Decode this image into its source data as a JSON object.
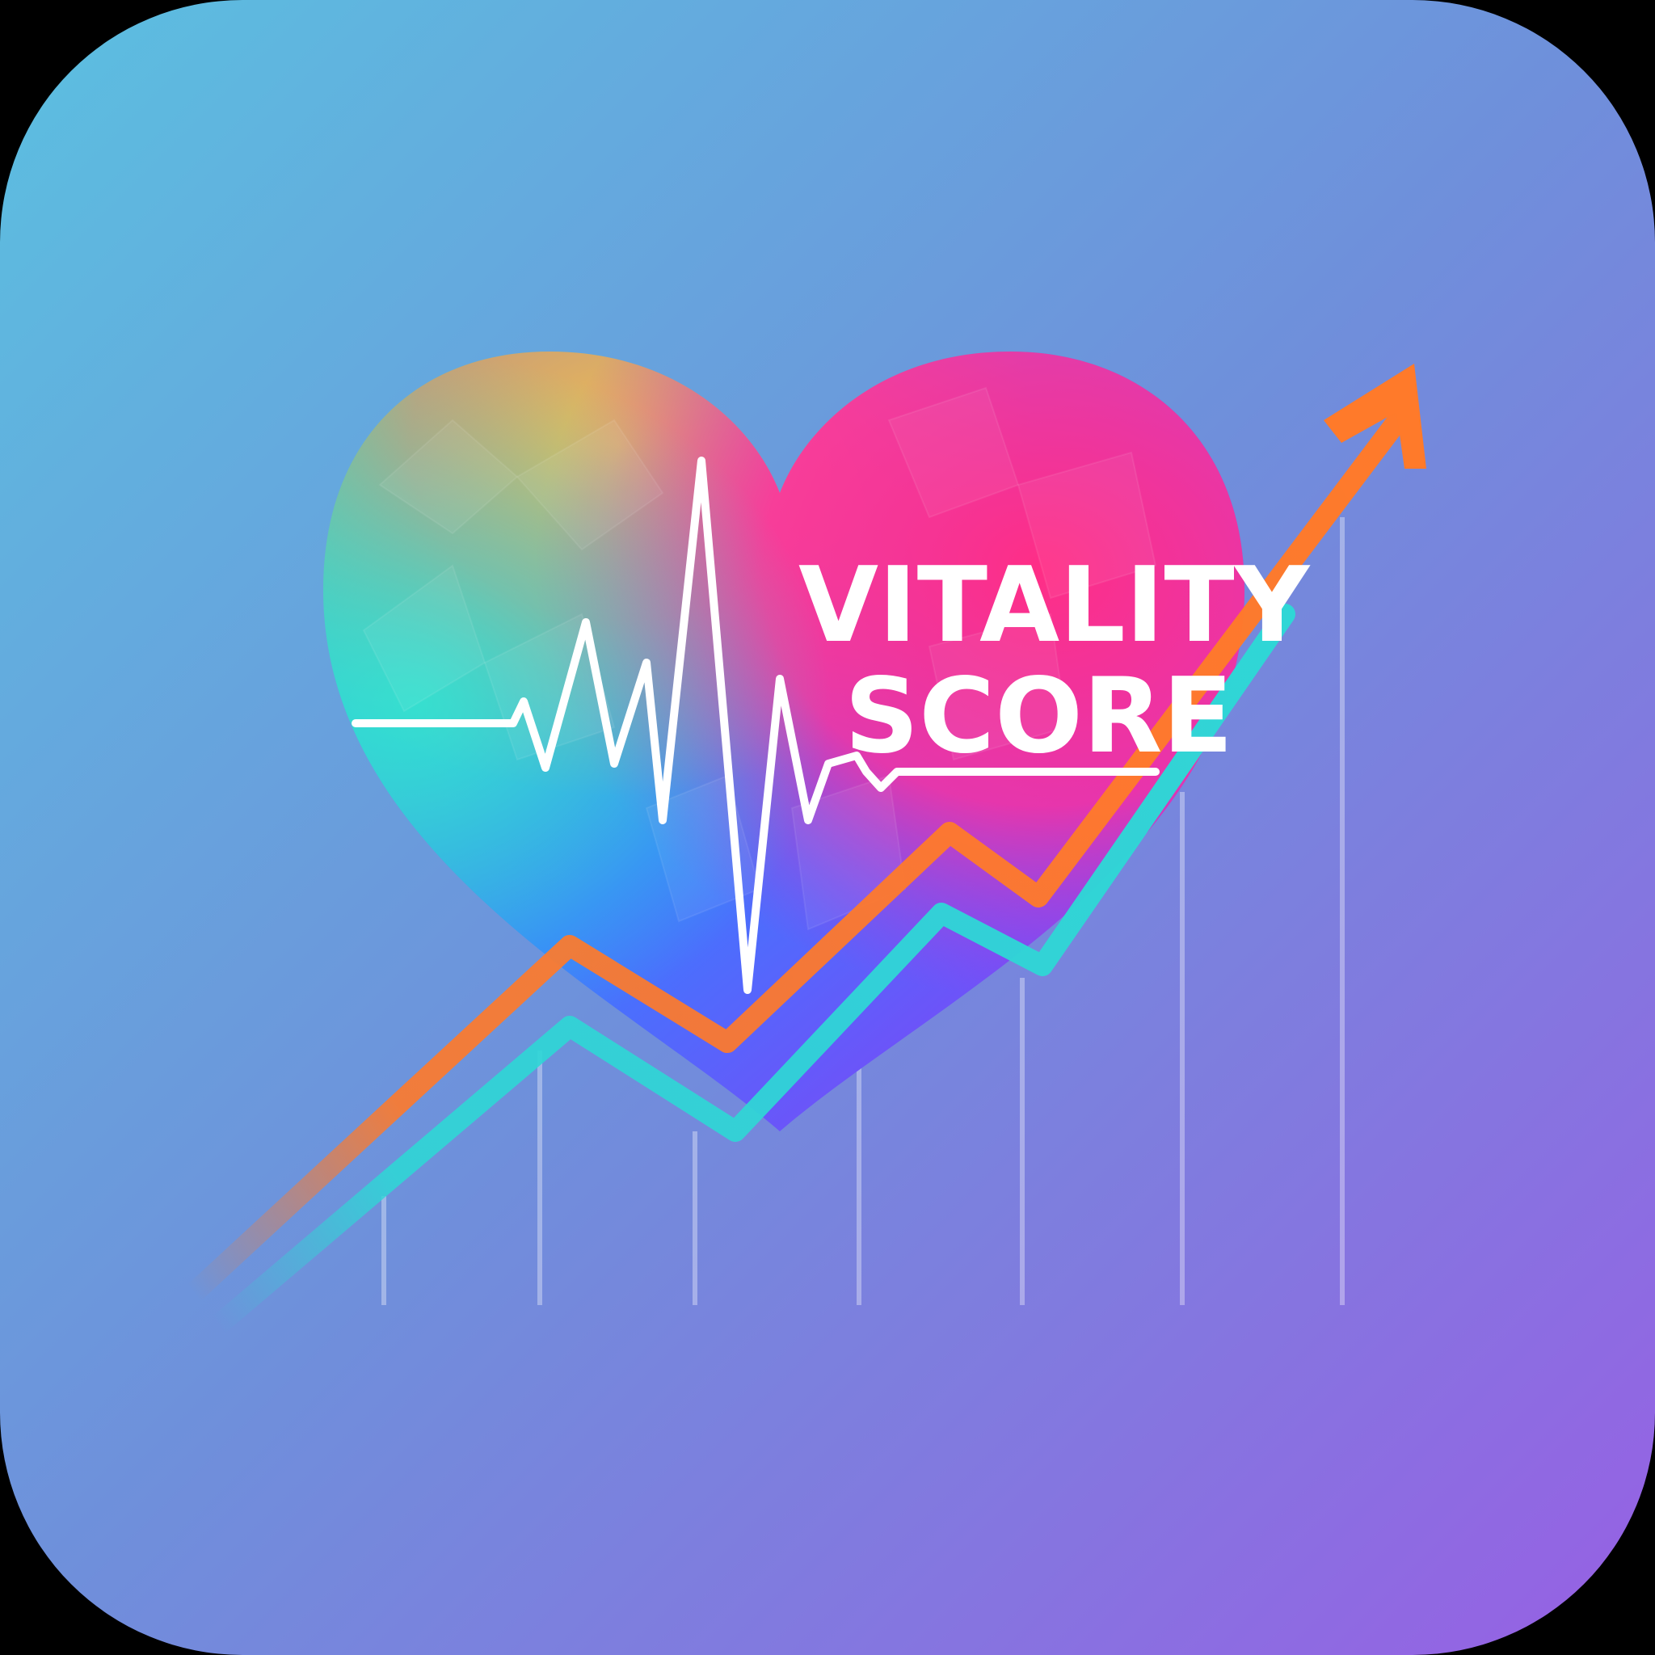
{
  "app_icon": {
    "title_line_1": "VITALITY",
    "title_line_2": "SCORE"
  },
  "colors": {
    "background_top_left": "#5bbde0",
    "background_bottom_right": "#9462e3",
    "heart_green": "#3fe0b4",
    "heart_yellow": "#f6c24a",
    "heart_pink": "#ff2e86",
    "heart_blue": "#3a7cff",
    "heart_purple": "#9b2ef3",
    "trend_orange": "#ff7a2a",
    "trend_cyan": "#2fd6d6",
    "pulse_white": "#ffffff"
  },
  "icons": [
    "heart-icon",
    "heartbeat-pulse-icon",
    "trend-arrow-icon",
    "trend-line-icon",
    "chart-grid-icon"
  ]
}
